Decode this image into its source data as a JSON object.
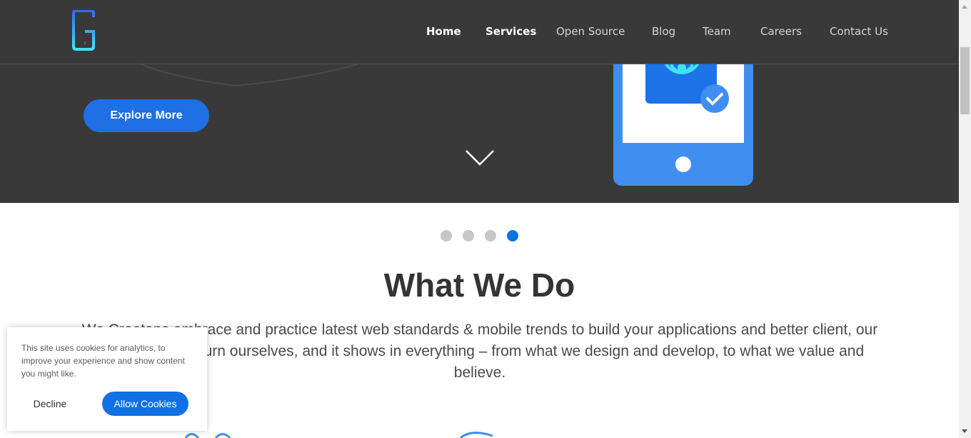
{
  "nav": {
    "items": [
      {
        "label": "Home",
        "active": true
      },
      {
        "label": "Services",
        "active": true
      },
      {
        "label": "Open Source",
        "active": false
      },
      {
        "label": "Blog",
        "active": false
      },
      {
        "label": "Team",
        "active": false
      },
      {
        "label": "Careers",
        "active": false
      },
      {
        "label": "Contact Us",
        "active": false
      }
    ]
  },
  "logo": {
    "icon": "g-logo-icon"
  },
  "hero": {
    "cta_label": "Explore More",
    "scroll_icon": "chevron-down-icon",
    "illustration": "phone-wifi-check-icon"
  },
  "carousel": {
    "slide_count": 4,
    "active_index": 3
  },
  "section": {
    "title": "What We Do",
    "paragraph": "We Creotans embrace and practice latest web standards & mobile trends to build your applications and better client, our partners and in turn ourselves, and it shows in everything – from what we design and develop, to what we value and believe."
  },
  "cookie_banner": {
    "text": "This site uses cookies for analytics, to improve your experience and show content you might like.",
    "decline_label": "Decline",
    "allow_label": "Allow Cookies"
  },
  "colors": {
    "hero_bg": "#3a3939",
    "accent": "#1f6fe5",
    "active_dot": "#0b72e7",
    "inactive_dot": "#c7c7c7"
  }
}
